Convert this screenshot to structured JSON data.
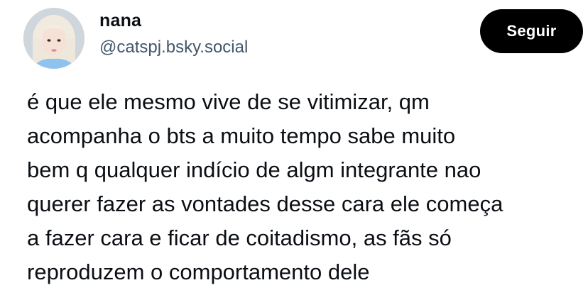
{
  "post": {
    "author": {
      "display_name": "nana",
      "handle": "@catspj.bsky.social",
      "avatar_icon": "profile-photo"
    },
    "follow_label": "Seguir",
    "text_lines": [
      "é que ele mesmo vive de se vitimizar, qm",
      "acompanha o bts a muito tempo sabe muito",
      "bem q qualquer indício de algm integrante nao",
      "querer fazer as vontades desse cara ele começa",
      "a fazer cara e ficar de coitadismo, as fãs só",
      "reproduzem o comportamento dele"
    ]
  },
  "colors": {
    "text": "#0b0f14",
    "handle": "#42576c",
    "button_bg": "#000000",
    "button_text": "#ffffff"
  }
}
